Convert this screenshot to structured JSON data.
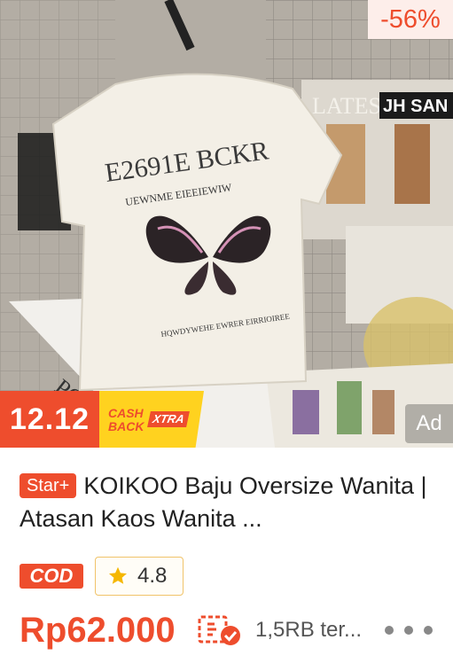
{
  "product": {
    "discount": "-56%",
    "promo": {
      "event": "12.12",
      "cashback_line1": "CASH",
      "cashback_line2": "BACK",
      "xtra": "XTRA"
    },
    "ad_label": "Ad",
    "image_text": {
      "shirt_line1": "E2691E BCKR",
      "shirt_line2": "UEWNME EIEEIEWIW",
      "shirt_line3": "HQWDYWEHE EWRER EIRRIOIREE",
      "magazine_title": "LATES",
      "magazine_brand": "JH SAN"
    },
    "star_badge": "Star+",
    "title": "KOIKOO  Baju Oversize Wanita | Atasan Kaos Wanita  ...",
    "cod_badge": "COD",
    "rating": "4.8",
    "price": "Rp62.000",
    "sold": "1,5RB ter...",
    "icons": {
      "rating": "star-icon",
      "shipping": "cod-check-icon",
      "more": "more-dots-icon"
    },
    "colors": {
      "accent": "#ee4d2d",
      "badge_bg": "#fdeeea",
      "cashback_yellow": "#ffd21f",
      "star": "#f5b700"
    }
  }
}
